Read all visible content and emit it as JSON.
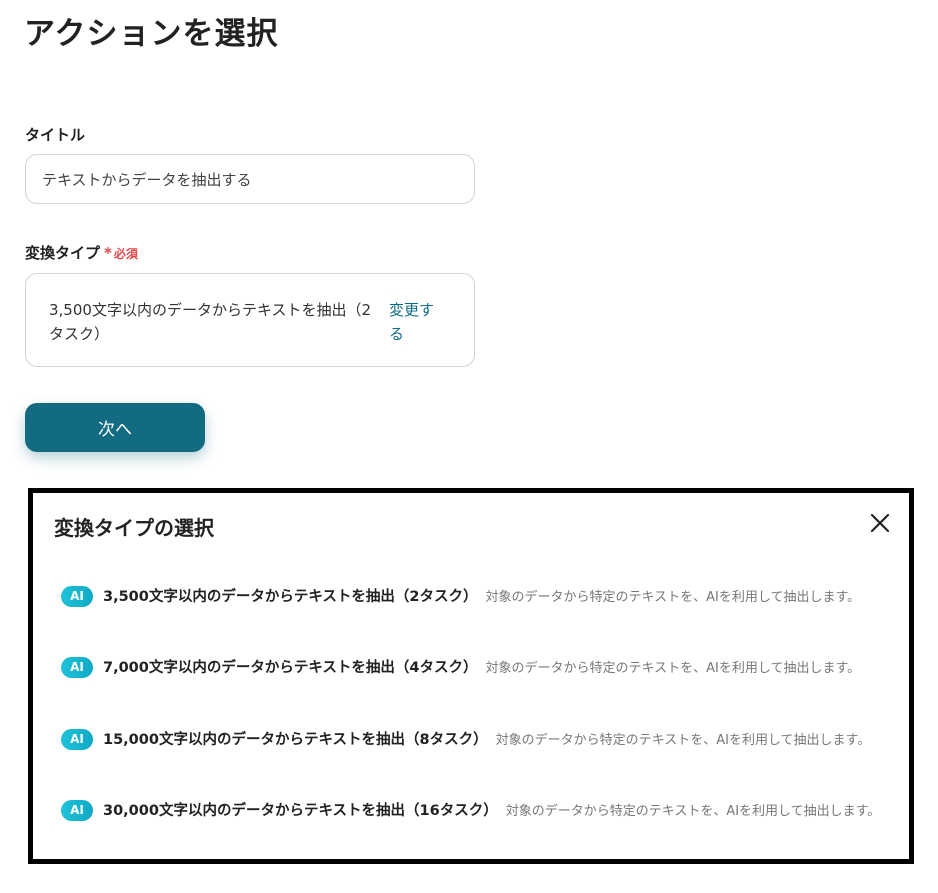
{
  "page": {
    "title": "アクションを選択"
  },
  "form": {
    "title_label": "タイトル",
    "title_value": "テキストからデータを抽出する",
    "type_label": "変換タイプ",
    "required_mark": "*",
    "required_text": "必須",
    "type_value": "3,500文字以内のデータからテキストを抽出（2タスク）",
    "change_link": "変更する",
    "next_button": "次へ"
  },
  "modal": {
    "title": "変換タイプの選択",
    "close_icon": "close-icon",
    "options": [
      {
        "badge": "AI",
        "title": "3,500文字以内のデータからテキストを抽出（2タスク）",
        "description": "対象のデータから特定のテキストを、AIを利用して抽出します。"
      },
      {
        "badge": "AI",
        "title": "7,000文字以内のデータからテキストを抽出（4タスク）",
        "description": "対象のデータから特定のテキストを、AIを利用して抽出します。"
      },
      {
        "badge": "AI",
        "title": "15,000文字以内のデータからテキストを抽出（8タスク）",
        "description": "対象のデータから特定のテキストを、AIを利用して抽出します。"
      },
      {
        "badge": "AI",
        "title": "30,000文字以内のデータからテキストを抽出（16タスク）",
        "description": "対象のデータから特定のテキストを、AIを利用して抽出します。"
      }
    ]
  },
  "colors": {
    "primary": "#136b82",
    "link": "#0e6c86",
    "required": "#e5484d",
    "ai_badge": "#1fc3d9"
  }
}
